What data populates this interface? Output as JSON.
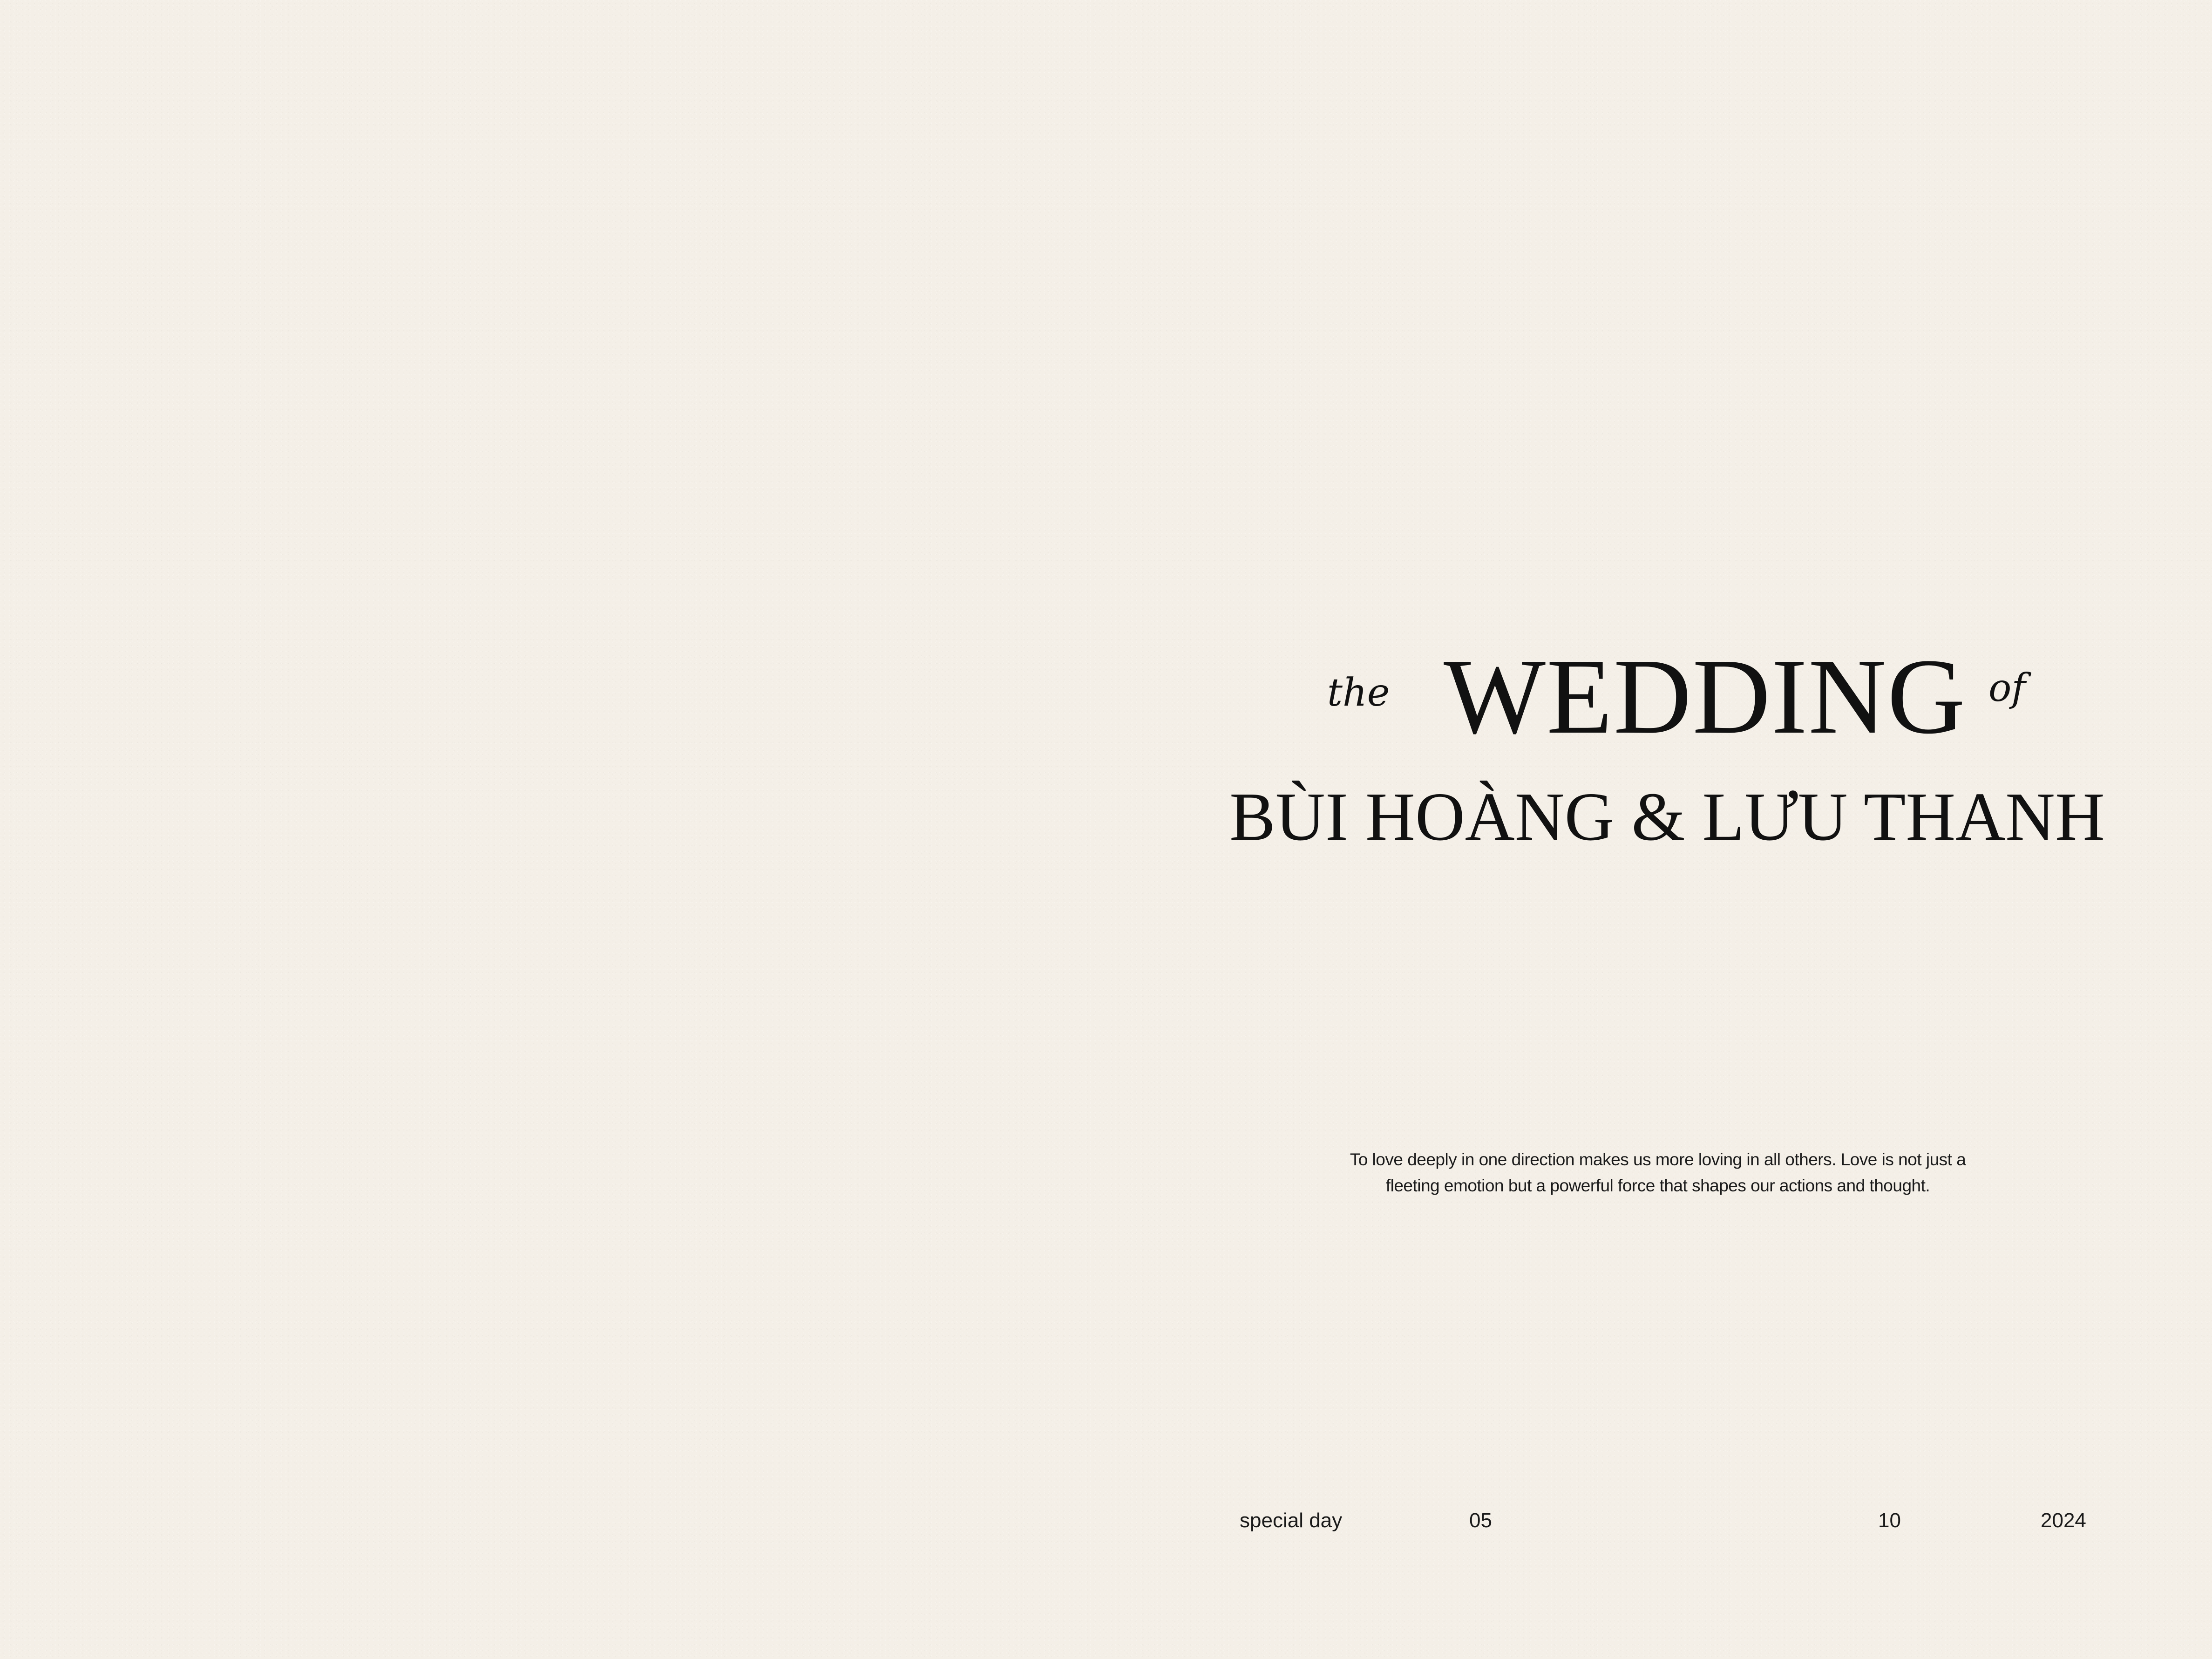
{
  "title": {
    "prefix": "the",
    "main": "WEDDING",
    "suffix": "of"
  },
  "couple": {
    "names": "BÙI HOÀNG & LƯU THANH"
  },
  "quote": {
    "line1": "To love deeply in one direction makes us more loving in all others. Love is not just a",
    "line2": "fleeting emotion but a powerful force that shapes our actions and thought."
  },
  "footer": {
    "label": "special day",
    "day": "05",
    "month": "10",
    "year": "2024"
  },
  "colors": {
    "paper": "#f4efe7",
    "ink": "#111111"
  }
}
